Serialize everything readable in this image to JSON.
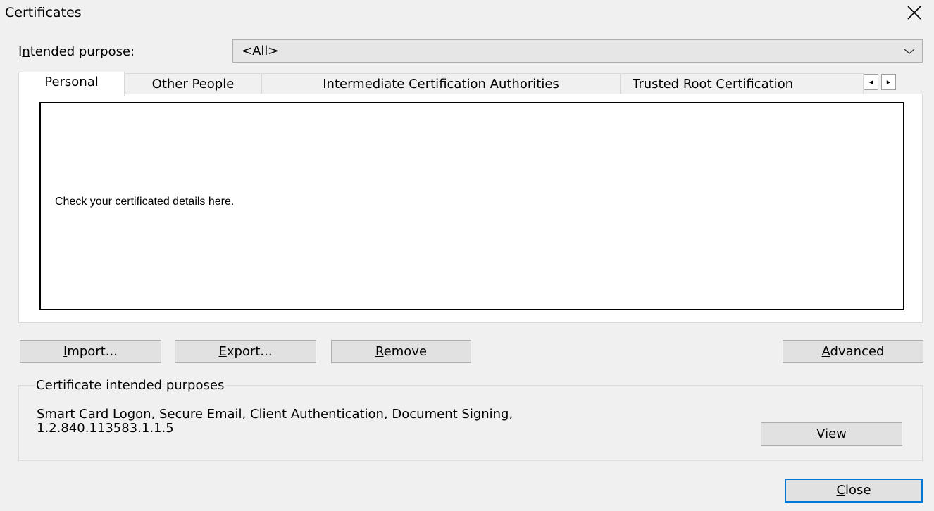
{
  "window": {
    "title": "Certificates",
    "close_icon": "close-icon"
  },
  "purpose": {
    "label": "Intended purpose:",
    "label_access_key": "n",
    "selected": "<All>"
  },
  "tabs": [
    {
      "label": "Personal",
      "active": true
    },
    {
      "label": "Other People",
      "active": false
    },
    {
      "label": "Intermediate Certification Authorities",
      "active": false
    },
    {
      "label": "Trusted Root Certification",
      "active": false
    }
  ],
  "tab_scroll": {
    "left": "◂",
    "right": "▸"
  },
  "list": {
    "message": "Check your certificated details here."
  },
  "buttons": {
    "import": {
      "label": "Import...",
      "access_key": "I"
    },
    "export": {
      "label": "Export...",
      "access_key": "E"
    },
    "remove": {
      "label": "Remove",
      "access_key": "R"
    },
    "advanced": {
      "label": "Advanced",
      "access_key": "A"
    },
    "view": {
      "label": "View",
      "access_key": "V"
    },
    "close": {
      "label": "Close",
      "access_key": "C"
    }
  },
  "intended_purposes": {
    "legend": "Certificate intended purposes",
    "line1": "Smart Card Logon, Secure Email, Client Authentication, Document Signing,",
    "line2": "1.2.840.113583.1.1.5"
  },
  "colors": {
    "background": "#f0f0f0",
    "focus_border": "#0078d7",
    "button_face": "#e1e1e1"
  }
}
